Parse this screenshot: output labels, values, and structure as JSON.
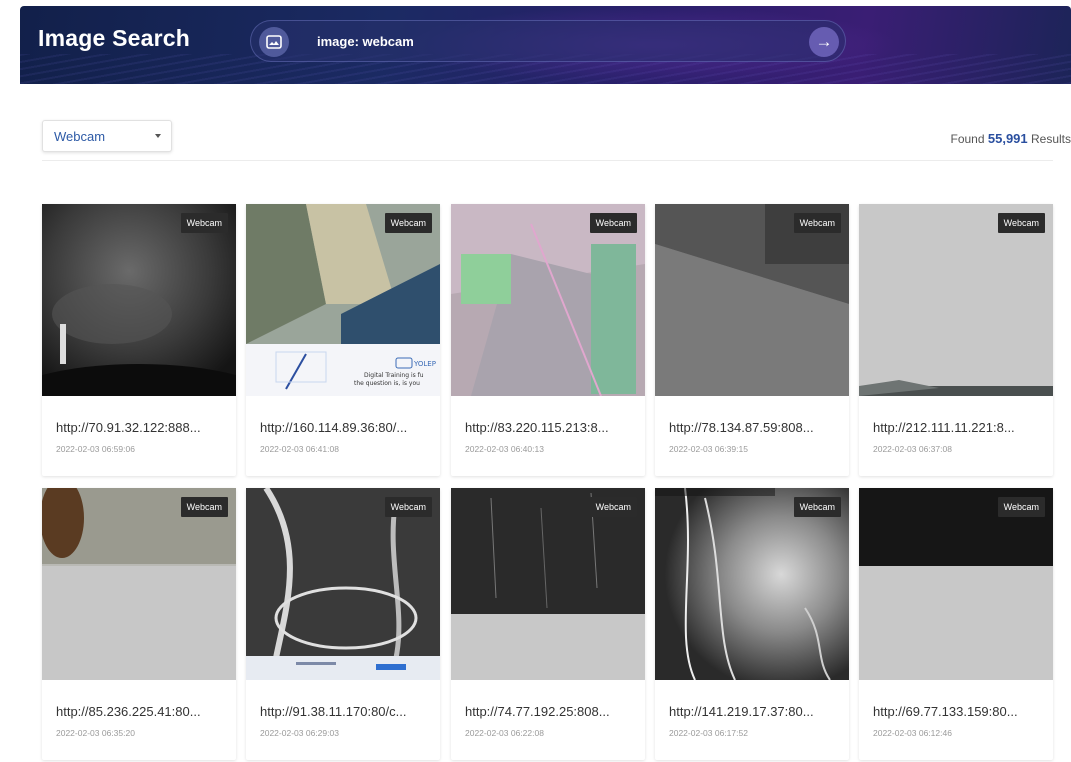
{
  "app": {
    "title": "Image Search"
  },
  "search": {
    "query": "image: webcam"
  },
  "filter": {
    "selected": "Webcam"
  },
  "results": {
    "prefix": "Found",
    "count": "55,991",
    "suffix": "Results"
  },
  "cards": [
    {
      "badge": "Webcam",
      "url": "http://70.91.32.122:888...",
      "time": "2022-02-03 06:59:06"
    },
    {
      "badge": "Webcam",
      "url": "http://160.114.89.36:80/...",
      "time": "2022-02-03 06:41:08",
      "overlay": {
        "brand": "YOLEP",
        "line1": "Digital Training is fu",
        "line2": "the question is, is you"
      }
    },
    {
      "badge": "Webcam",
      "url": "http://83.220.115.213:8...",
      "time": "2022-02-03 06:40:13"
    },
    {
      "badge": "Webcam",
      "url": "http://78.134.87.59:808...",
      "time": "2022-02-03 06:39:15"
    },
    {
      "badge": "Webcam",
      "url": "http://212.111.11.221:8...",
      "time": "2022-02-03 06:37:08"
    },
    {
      "badge": "Webcam",
      "url": "http://85.236.225.41:80...",
      "time": "2022-02-03 06:35:20"
    },
    {
      "badge": "Webcam",
      "url": "http://91.38.11.170:80/c...",
      "time": "2022-02-03 06:29:03"
    },
    {
      "badge": "Webcam",
      "url": "http://74.77.192.25:808...",
      "time": "2022-02-03 06:22:08"
    },
    {
      "badge": "Webcam",
      "url": "http://141.219.17.37:80...",
      "time": "2022-02-03 06:17:52"
    },
    {
      "badge": "Webcam",
      "url": "http://69.77.133.159:80...",
      "time": "2022-02-03 06:12:46"
    }
  ]
}
